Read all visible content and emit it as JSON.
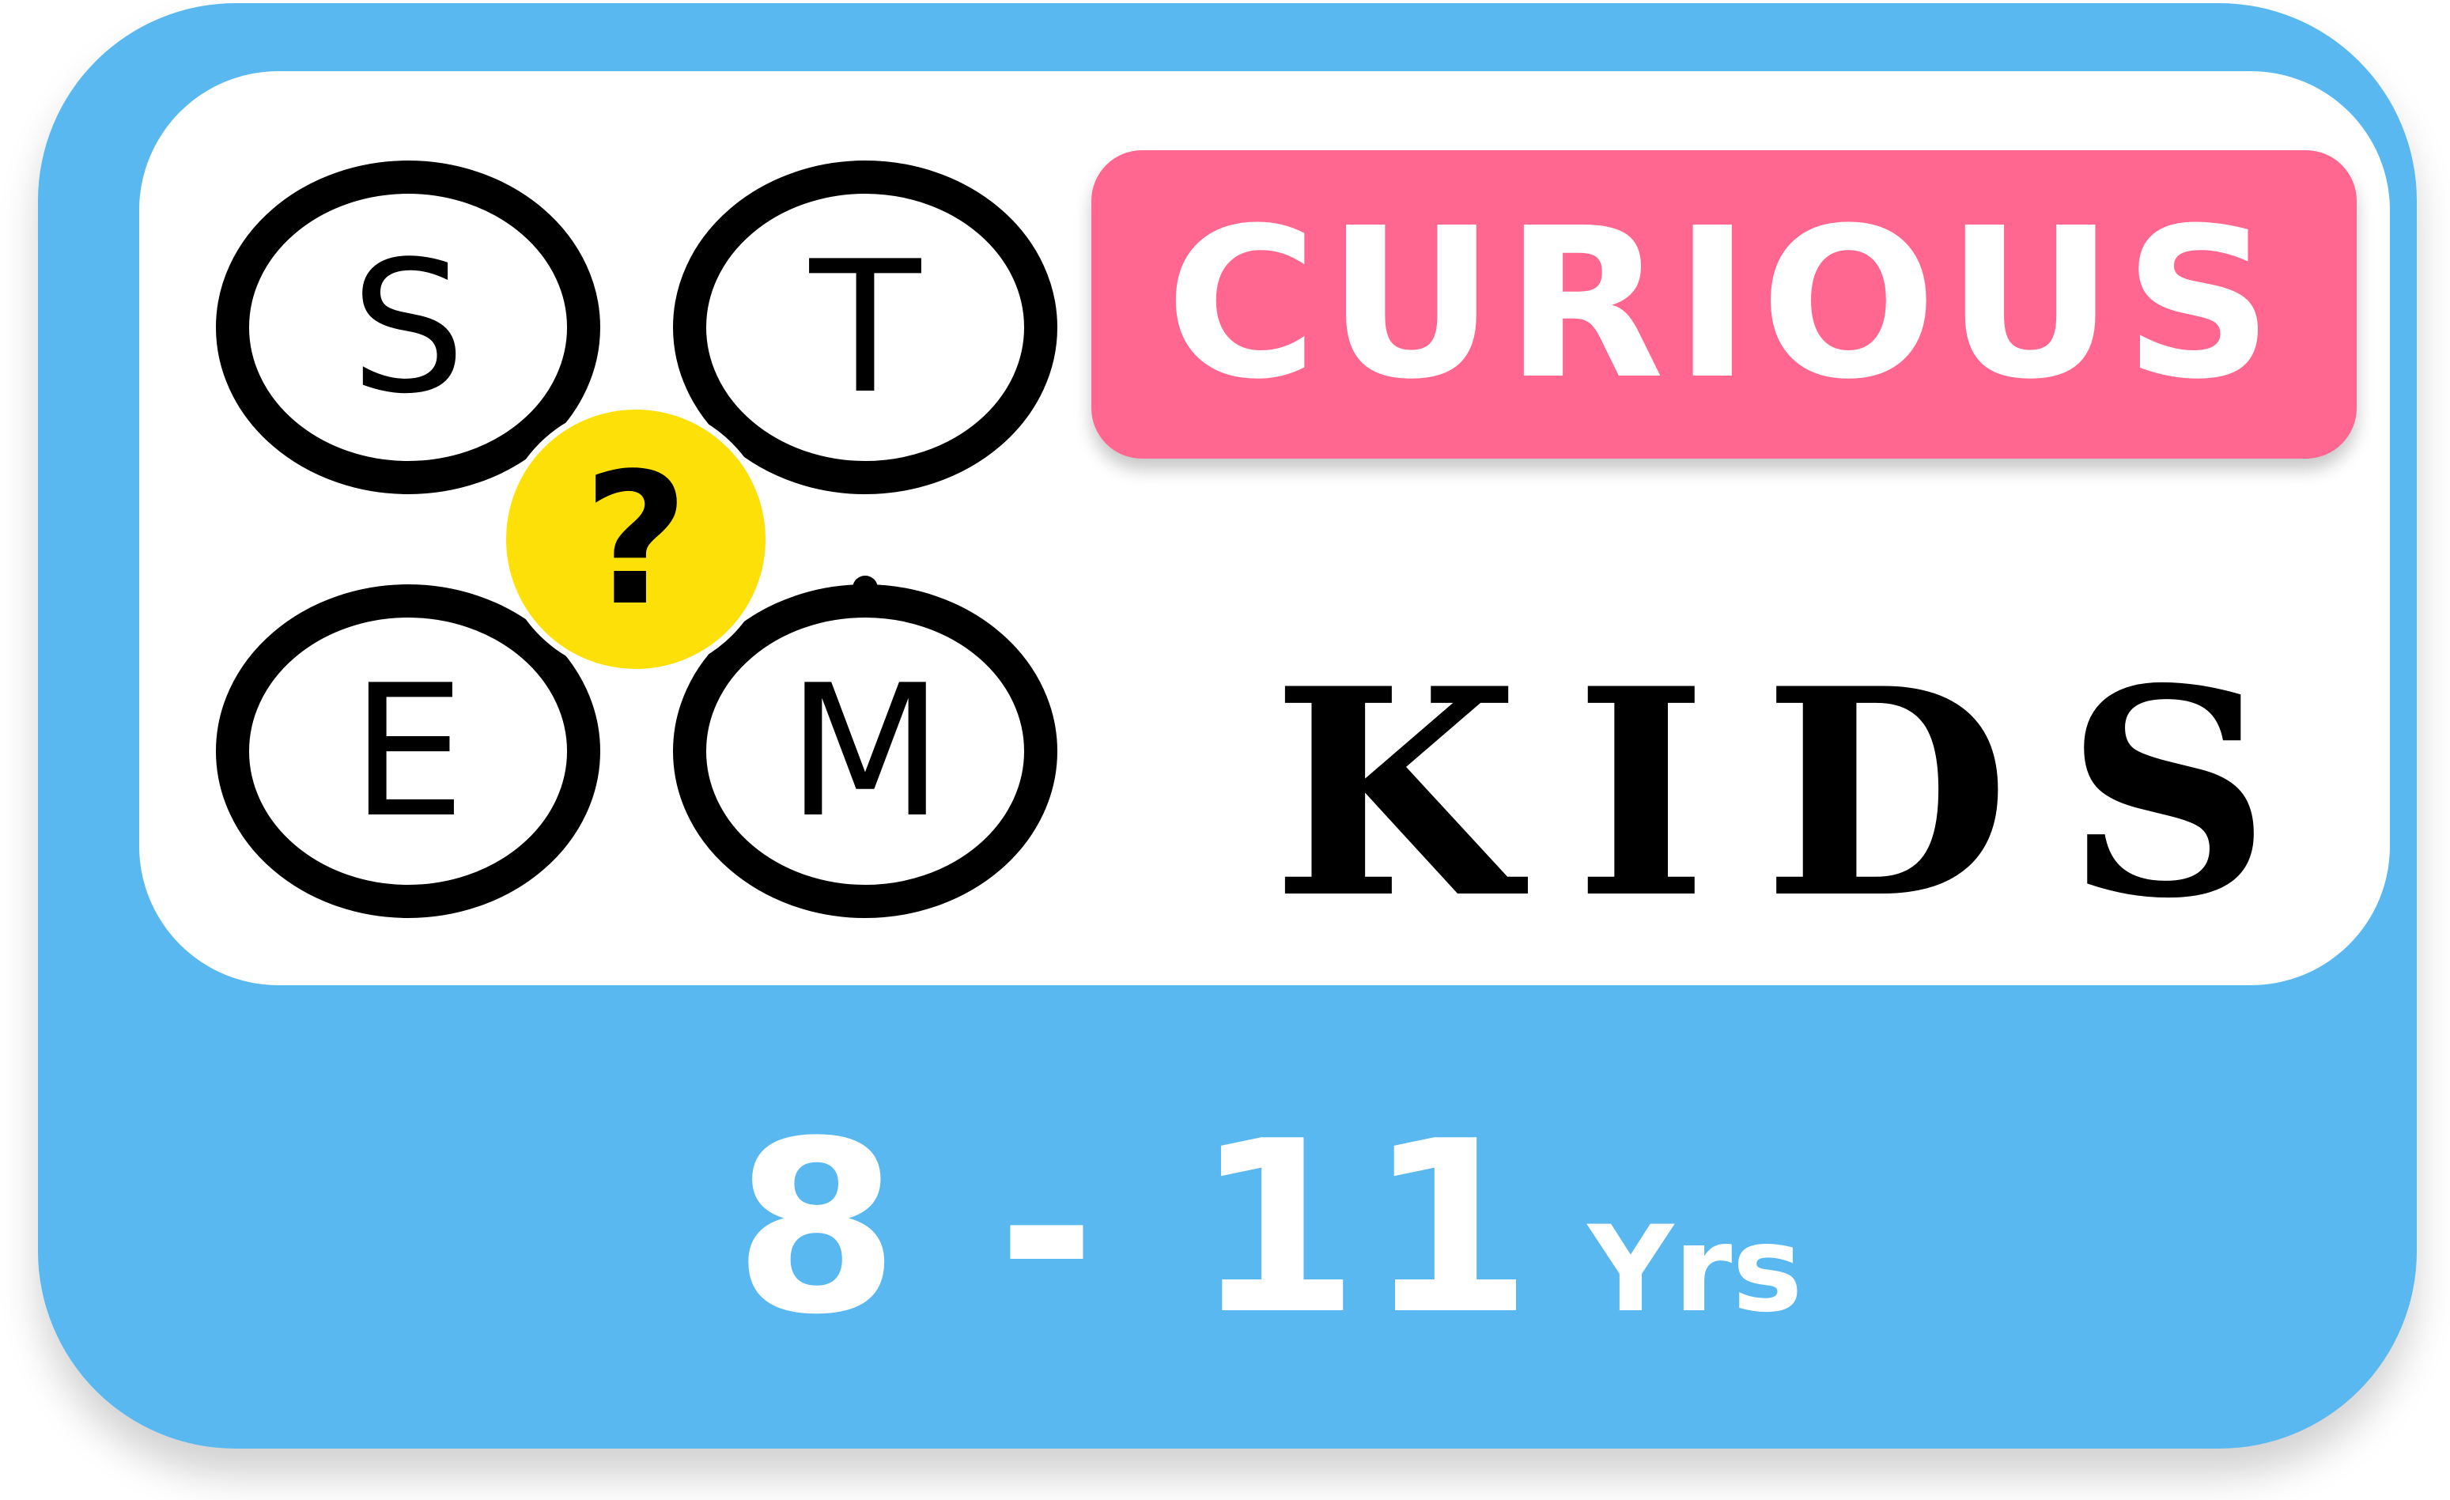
{
  "colors": {
    "card_blue": "#5ab8f0",
    "banner_pink": "#ff6791",
    "question_yellow": "#fee009",
    "text_black": "#000000",
    "text_white": "#ffffff"
  },
  "logo": {
    "letters": [
      "S",
      "T",
      "E",
      "M"
    ],
    "question_mark": "?"
  },
  "banner": {
    "title": "CURIOUS"
  },
  "subtitle": "KIDS",
  "age": {
    "range": "8 - 11",
    "unit": "Yrs"
  }
}
